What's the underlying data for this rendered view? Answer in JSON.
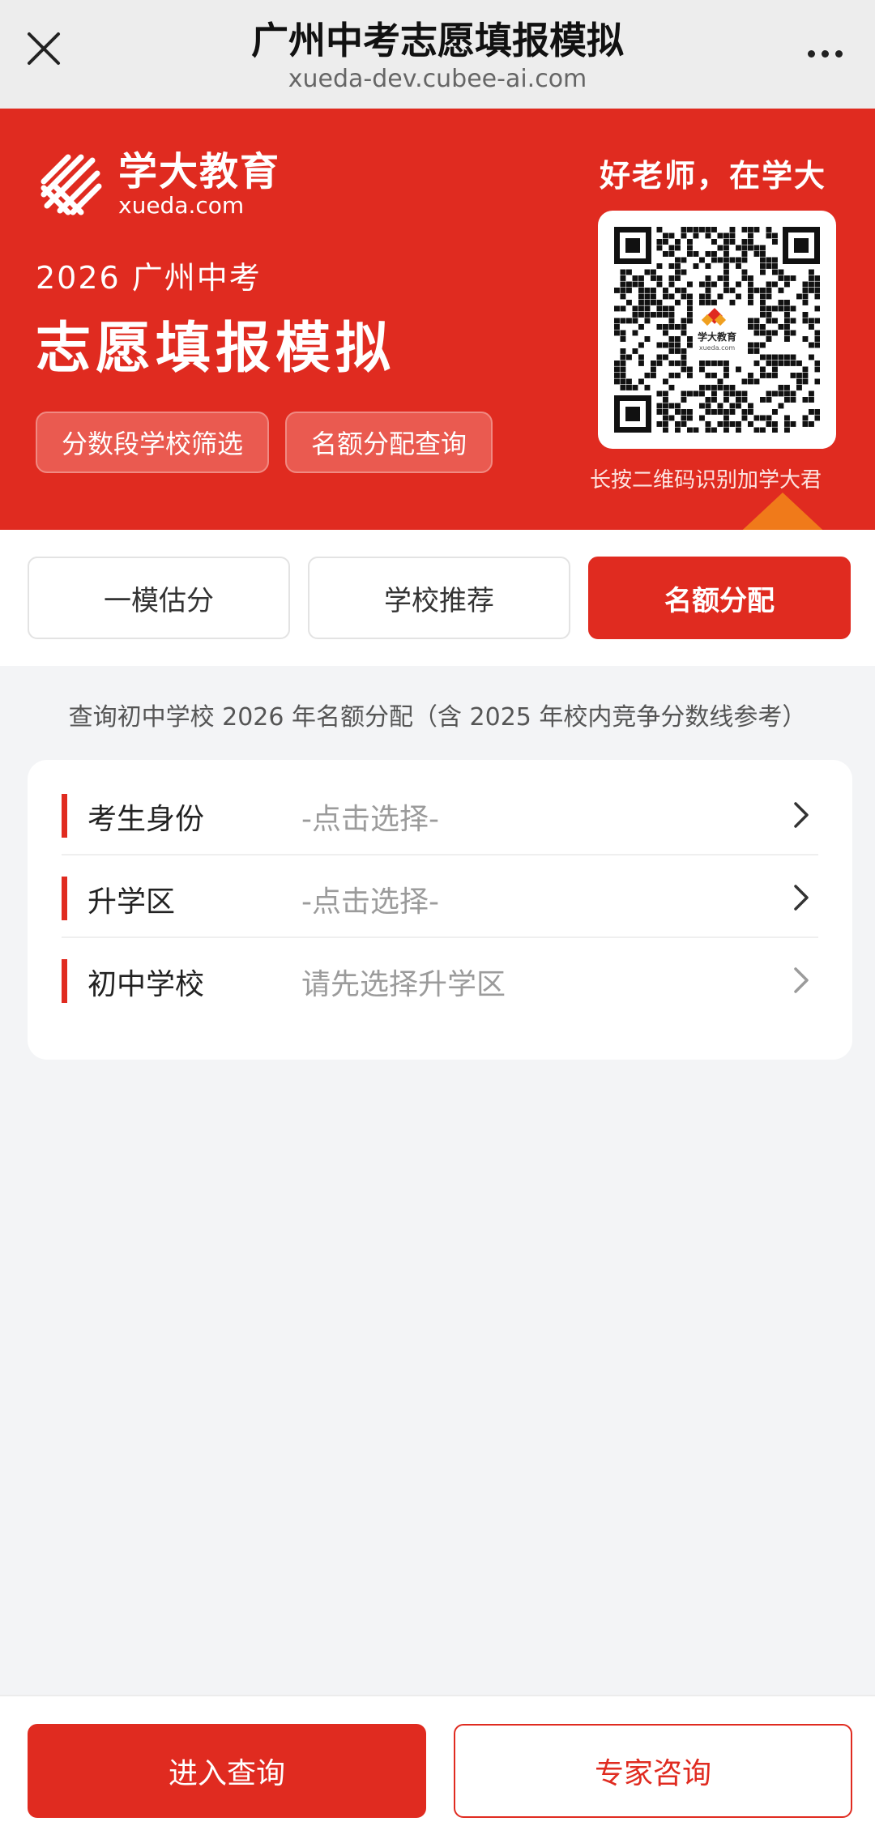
{
  "nav": {
    "title": "广州中考志愿填报模拟",
    "url": "xueda-dev.cubee-ai.com",
    "close_icon": "close-icon",
    "more_icon": "more-icon"
  },
  "banner": {
    "logo_cn": "学大教育",
    "logo_en": "xueda.com",
    "subtitle": "2026 广州中考",
    "title": "志愿填报模拟",
    "chips": [
      "分数段学校筛选",
      "名额分配查询"
    ],
    "slogan": "好老师，在学大",
    "qr_caption": "长按二维码识别加学大君",
    "qr_center_cn": "学大教育",
    "qr_center_en": "xueda.com"
  },
  "tabs": [
    {
      "label": "一模估分",
      "active": false
    },
    {
      "label": "学校推荐",
      "active": false
    },
    {
      "label": "名额分配",
      "active": true
    }
  ],
  "description": "查询初中学校 2026 年名额分配（含 2025 年校内竞争分数线参考）",
  "form": {
    "rows": [
      {
        "label": "考生身份",
        "value": "-点击选择-"
      },
      {
        "label": "升学区",
        "value": "-点击选择-"
      },
      {
        "label": "初中学校",
        "value": "请先选择升学区"
      }
    ]
  },
  "buttons": {
    "query": "进入查询",
    "consult": "专家咨询"
  },
  "colors": {
    "primary": "#e02b20",
    "accent_orange": "#f07a1a"
  }
}
